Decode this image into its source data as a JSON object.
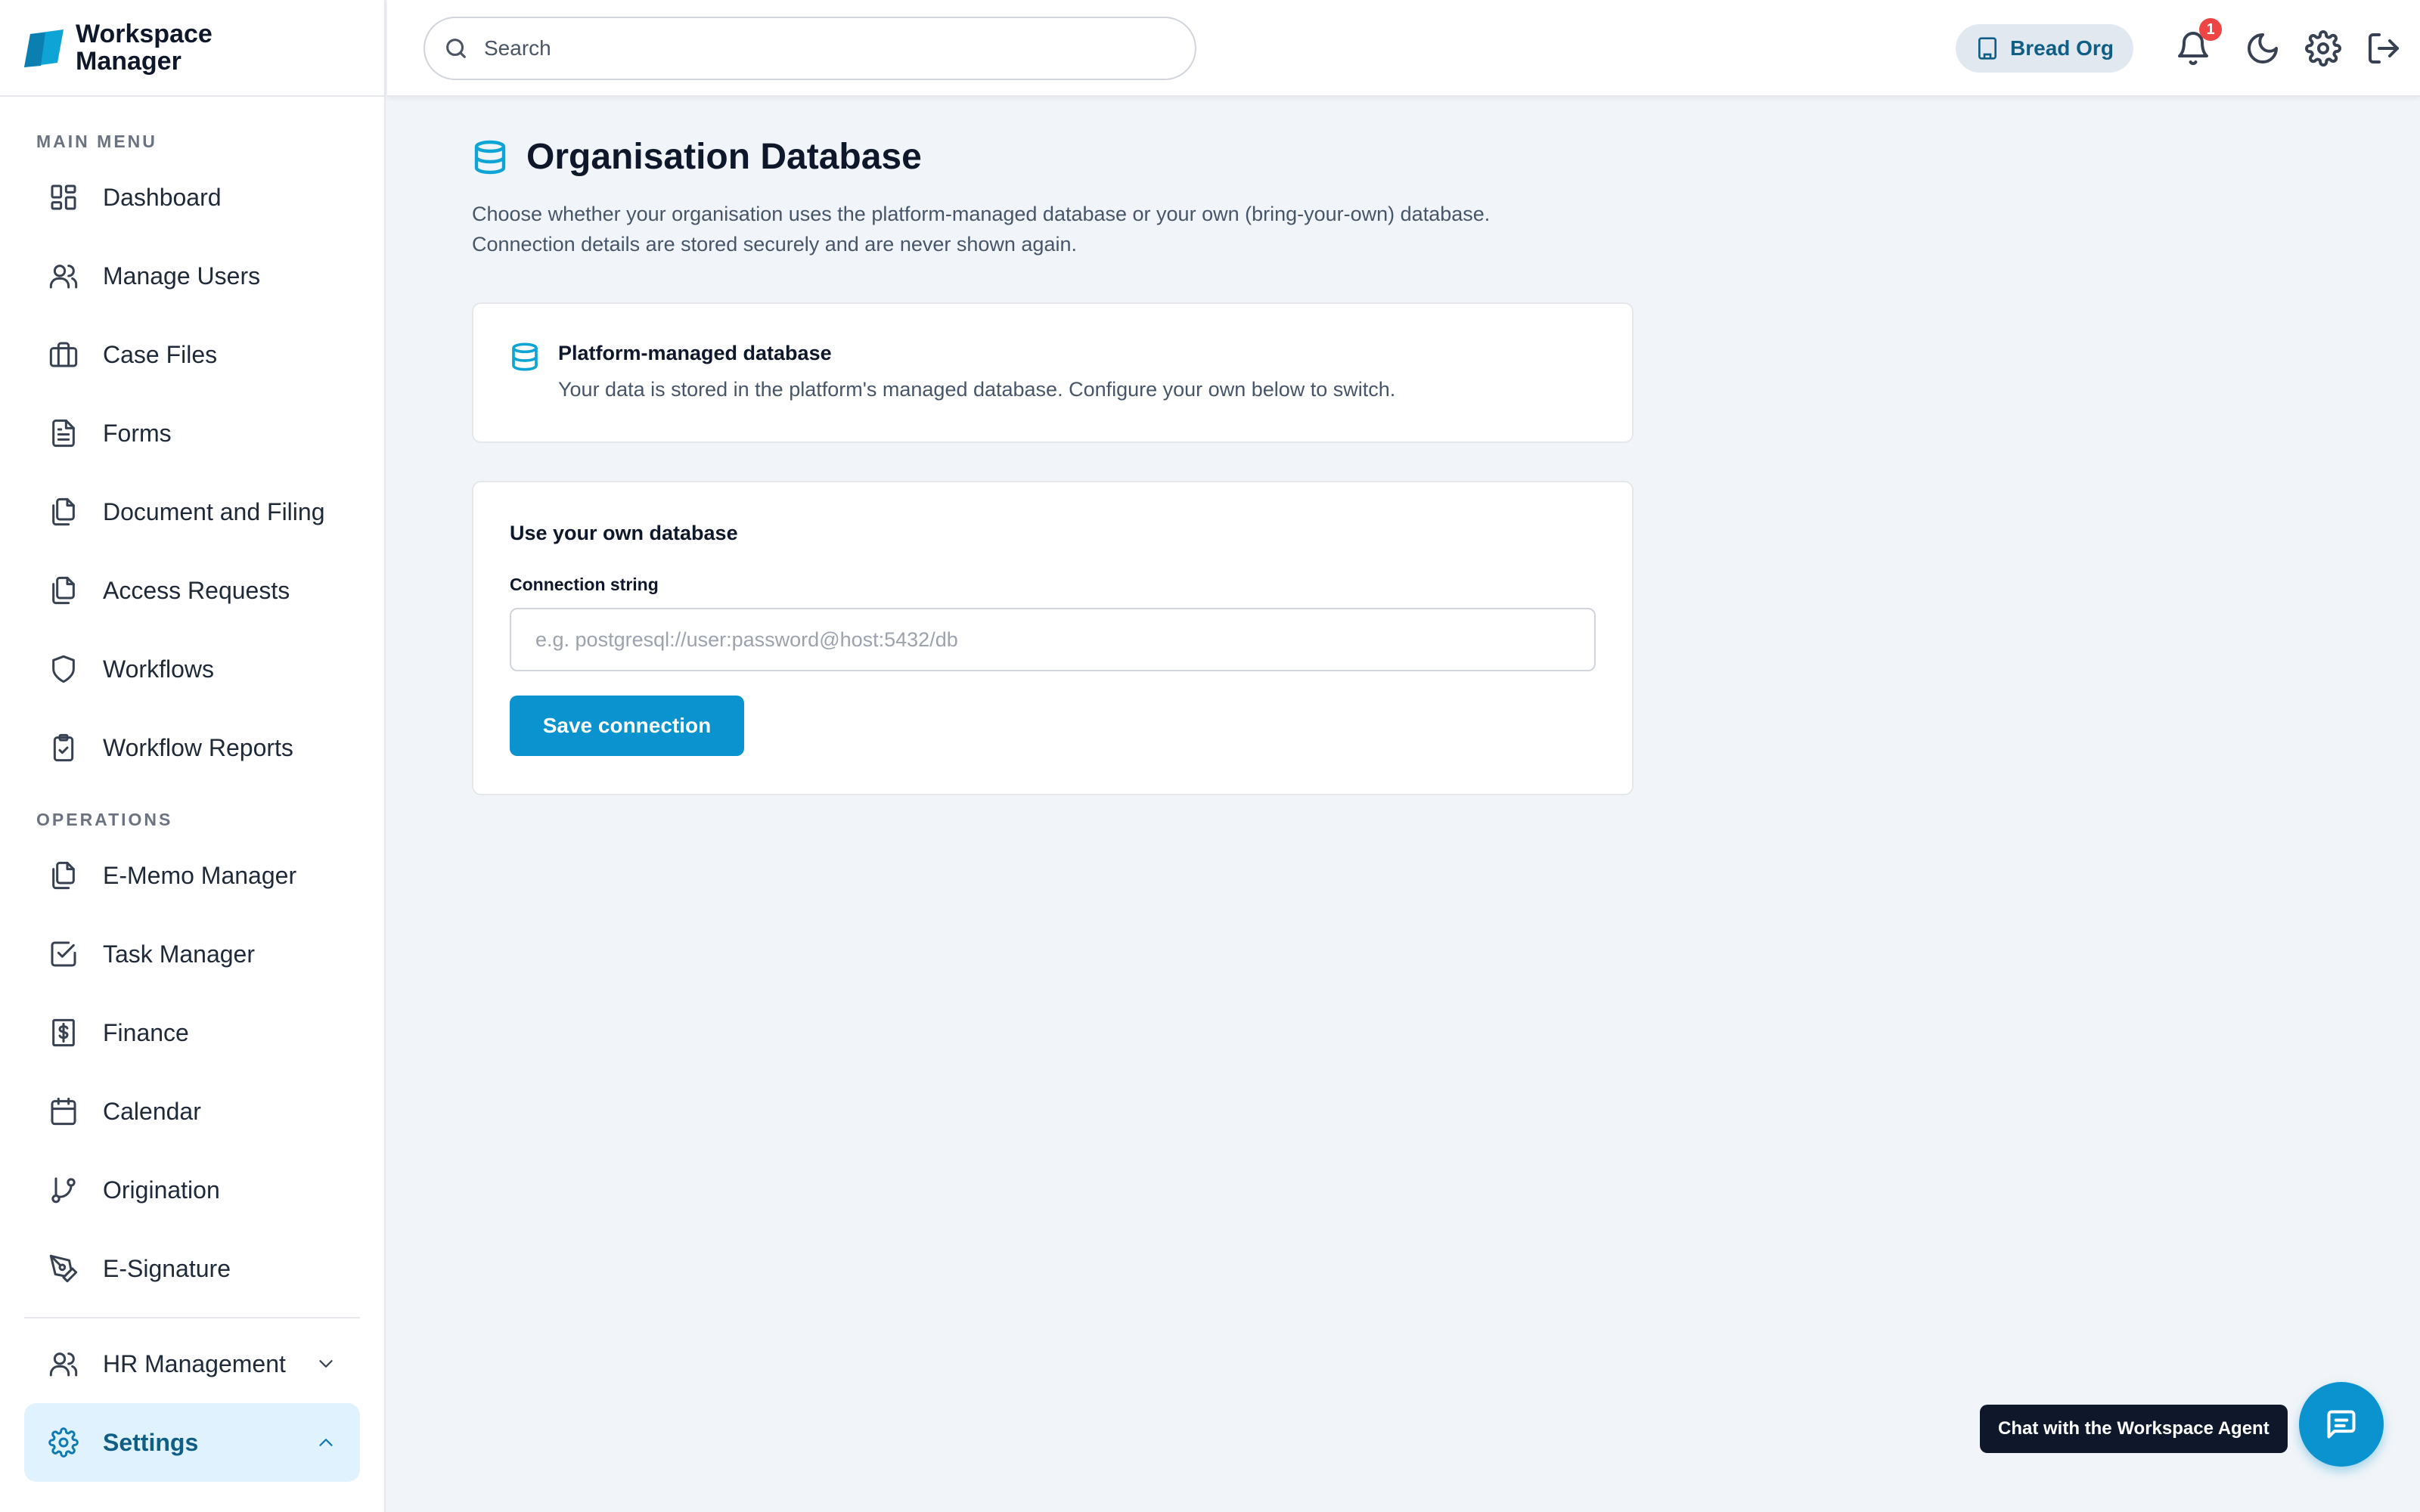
{
  "app": {
    "brand_line1": "Workspace",
    "brand_line2": "Manager",
    "accent_color": "#0b93cf"
  },
  "sidebar": {
    "main_menu_label": "MAIN MENU",
    "main_items": [
      {
        "label": "Dashboard",
        "icon": "dashboard-icon"
      },
      {
        "label": "Manage Users",
        "icon": "users-icon"
      },
      {
        "label": "Case Files",
        "icon": "briefcase-icon"
      },
      {
        "label": "Forms",
        "icon": "file-text-icon"
      },
      {
        "label": "Document and Filing",
        "icon": "files-icon"
      },
      {
        "label": "Access Requests",
        "icon": "files-icon"
      },
      {
        "label": "Workflows",
        "icon": "shield-icon"
      },
      {
        "label": "Workflow Reports",
        "icon": "clipboard-check-icon"
      }
    ],
    "operations_label": "OPERATIONS",
    "operations_items": [
      {
        "label": "E-Memo Manager",
        "icon": "files-icon"
      },
      {
        "label": "Task Manager",
        "icon": "square-check-icon"
      },
      {
        "label": "Finance",
        "icon": "dollar-icon"
      },
      {
        "label": "Calendar",
        "icon": "calendar-icon"
      },
      {
        "label": "Origination",
        "icon": "git-branch-icon"
      },
      {
        "label": "E-Signature",
        "icon": "pen-icon"
      }
    ],
    "hr_label": "HR Management",
    "settings_label": "Settings"
  },
  "topbar": {
    "search_placeholder": "Search",
    "org_name": "Bread Org",
    "notification_count": "1"
  },
  "page": {
    "title": "Organisation Database",
    "description_line1": "Choose whether your organisation uses the platform-managed database or your own (bring-your-own) database.",
    "description_line2": "Connection details are stored securely and are never shown again."
  },
  "platform_card": {
    "title": "Platform-managed database",
    "subtitle": "Your data is stored in the platform's managed database. Configure your own below to switch."
  },
  "byo_card": {
    "title": "Use your own database",
    "field_label": "Connection string",
    "field_placeholder": "e.g. postgresql://user:password@host:5432/db",
    "field_value": "",
    "save_label": "Save connection"
  },
  "chat": {
    "tooltip": "Chat with the Workspace Agent"
  }
}
